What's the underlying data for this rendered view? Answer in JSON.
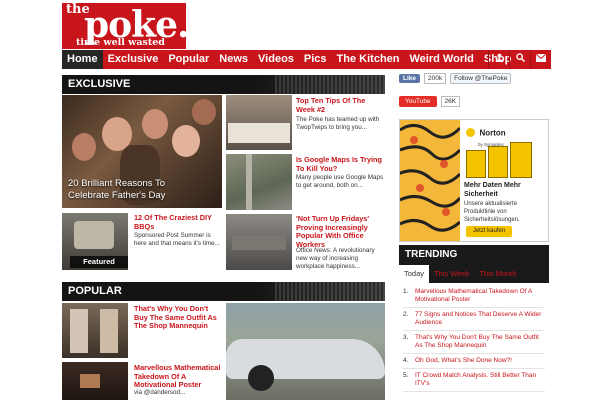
{
  "logo": {
    "the": "the",
    "poke": "poke.",
    "tagline": "time well wasted"
  },
  "nav": {
    "items": [
      "Home",
      "Exclusive",
      "Popular",
      "News",
      "Videos",
      "Pics",
      "The Kitchen",
      "Weird World",
      "Shop"
    ],
    "icons": [
      "user-icon",
      "search-icon",
      "mail-icon"
    ]
  },
  "exclusive": {
    "heading": "EXCLUSIVE",
    "hero": {
      "title": "20 Brilliant Reasons To Celebrate Father's Day"
    },
    "cards": [
      {
        "title": "Top Ten Tips Of The Week #2",
        "text": "The Poke has teamed up with TwopTwips to bring you..."
      },
      {
        "title": "Is Google Maps Is Trying To Kill You?",
        "text": "Many people use Google Maps to get around, both on..."
      },
      {
        "title": "'Not Turn Up Fridays' Proving Increasingly Popular With Office Workers",
        "text": "Office News: A revolutionary new way of increasing workplace happiness..."
      },
      {
        "title": "12 Of The Craziest DIY BBQs",
        "text": "Sponsored Post Summer is here and that means it's time...",
        "badge": "Featured"
      }
    ]
  },
  "popular": {
    "heading": "POPULAR",
    "cards": [
      {
        "title": "That's Why You Don't Buy The Same Outfit As The Shop Mannequin",
        "text": ""
      },
      {
        "title": "Marvellous Mathematical Takedown Of A Motivational Poster",
        "text": "via @dandersod..."
      }
    ]
  },
  "sidebar": {
    "fb_like": "Like",
    "fb_count": "200k",
    "twitter_follow": "Follow @ThePoke",
    "youtube": "YouTube",
    "youtube_count": "26K",
    "ad": {
      "brand": "Norton",
      "sub_brand": "by Symantec",
      "headline": "Mehr Daten Mehr Sicherheit",
      "body": "Unsere aktualisierte Produktlinie von Sicherheitslösungen.",
      "button": "Jetzt kaufen"
    }
  },
  "trending": {
    "heading": "TRENDING",
    "tabs": [
      "Today",
      "This Week",
      "This Month"
    ],
    "items": [
      "Marvellous Mathematical Takedown Of A Motivational Poster",
      "77 Signs and Notices That Deserve A Wider Audience",
      "That's Why You Don't Buy The Same Outfit As The Shop Mannequin",
      "Oh God, What's She Done Now?!",
      "IT Crowd Match Analysis. Still Better Than ITV's"
    ]
  },
  "colors": {
    "brand": "#c8151b",
    "dark": "#1a1a1a"
  }
}
